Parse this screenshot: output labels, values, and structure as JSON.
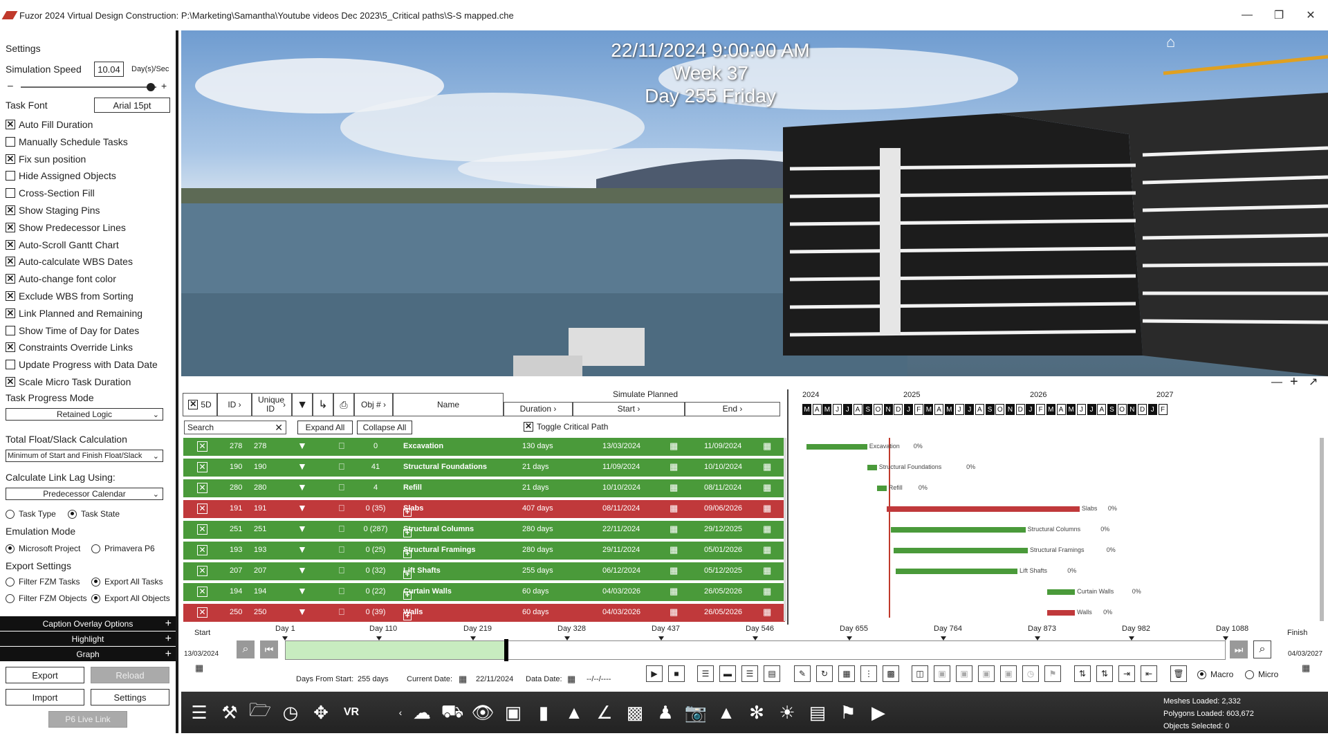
{
  "window": {
    "title": "Fuzor 2024 Virtual Design Construction: P:\\Marketing\\Samantha\\Youtube videos Dec 2023\\5_Critical paths\\S-S mapped.che"
  },
  "settings": {
    "header": "Settings",
    "sim_speed_label": "Simulation Speed",
    "sim_speed_value": "10.04",
    "sim_speed_unit": "Day(s)/Sec",
    "sim_speed_fraction": 0.96,
    "task_font_label": "Task Font",
    "task_font_value": "Arial 15pt",
    "checkboxes": [
      {
        "label": "Auto Fill Duration",
        "checked": true
      },
      {
        "label": "Manually Schedule Tasks",
        "checked": false
      },
      {
        "label": "Fix sun position",
        "checked": true
      },
      {
        "label": "Hide Assigned Objects",
        "checked": false
      },
      {
        "label": "Cross-Section Fill",
        "checked": false
      },
      {
        "label": "Show Staging Pins",
        "checked": true
      },
      {
        "label": "Show Predecessor Lines",
        "checked": true
      },
      {
        "label": "Auto-Scroll Gantt Chart",
        "checked": true
      },
      {
        "label": "Auto-calculate WBS Dates",
        "checked": true
      },
      {
        "label": "Auto-change font color",
        "checked": true
      },
      {
        "label": "Exclude WBS from Sorting",
        "checked": true
      },
      {
        "label": "Link Planned and Remaining",
        "checked": true
      },
      {
        "label": "Show Time of Day for Dates",
        "checked": false
      },
      {
        "label": "Constraints Override Links",
        "checked": true
      },
      {
        "label": "Update Progress with Data Date",
        "checked": false
      },
      {
        "label": "Scale Micro Task Duration",
        "checked": true
      }
    ],
    "task_progress_label": "Task Progress Mode",
    "task_progress_value": "Retained Logic",
    "float_label": "Total Float/Slack Calculation",
    "float_value": "Minimum of Start and Finish Float/Slack",
    "lag_label": "Calculate Link Lag Using:",
    "lag_value": "Predecessor Calendar",
    "task_type": "Task Type",
    "task_state": "Task State",
    "emulation_label": "Emulation Mode",
    "emu_ms": "Microsoft Project",
    "emu_p6": "Primavera P6",
    "export_label": "Export Settings",
    "filter_tasks": "Filter FZM Tasks",
    "export_all_tasks": "Export All Tasks",
    "filter_objects": "Filter FZM Objects",
    "export_all_objects": "Export All Objects",
    "sections": [
      "Caption Overlay Options",
      "Highlight",
      "Graph"
    ],
    "btn_export": "Export",
    "btn_reload": "Reload",
    "btn_import": "Import",
    "btn_settings": "Settings",
    "btn_p6": "P6 Live Link"
  },
  "overlay": {
    "datetime": "22/11/2024 9:00:00 AM",
    "week": "Week 37",
    "day": "Day 255 Friday"
  },
  "table": {
    "col_5d": "5D",
    "col_id": "ID",
    "col_uid": "Unique ID",
    "col_obj": "Obj #",
    "col_name": "Name",
    "sim_planned": "Simulate Planned",
    "col_duration": "Duration",
    "col_start": "Start",
    "col_end": "End",
    "search_placeholder": "Search",
    "expand_all": "Expand All",
    "collapse_all": "Collapse All",
    "toggle_critical": "Toggle Critical Path",
    "rows": [
      {
        "id": "278",
        "uid": "278",
        "obj": "0",
        "name": "Excavation",
        "dur": "130 days",
        "start": "13/03/2024",
        "end": "11/09/2024",
        "status": "green",
        "group": false
      },
      {
        "id": "190",
        "uid": "190",
        "obj": "41",
        "name": "Structural Foundations",
        "dur": "21 days",
        "start": "11/09/2024",
        "end": "10/10/2024",
        "status": "green",
        "group": false
      },
      {
        "id": "280",
        "uid": "280",
        "obj": "4",
        "name": "Refill",
        "dur": "21 days",
        "start": "10/10/2024",
        "end": "08/11/2024",
        "status": "green",
        "group": false
      },
      {
        "id": "191",
        "uid": "191",
        "obj": "0 (35)",
        "name": "Slabs",
        "dur": "407 days",
        "start": "08/11/2024",
        "end": "09/06/2026",
        "status": "red",
        "group": true
      },
      {
        "id": "251",
        "uid": "251",
        "obj": "0 (287)",
        "name": "Structural Columns",
        "dur": "280 days",
        "start": "22/11/2024",
        "end": "29/12/2025",
        "status": "green",
        "group": true
      },
      {
        "id": "193",
        "uid": "193",
        "obj": "0 (25)",
        "name": "Structural Framings",
        "dur": "280 days",
        "start": "29/11/2024",
        "end": "05/01/2026",
        "status": "green",
        "group": true
      },
      {
        "id": "207",
        "uid": "207",
        "obj": "0 (32)",
        "name": "Lift Shafts",
        "dur": "255 days",
        "start": "06/12/2024",
        "end": "05/12/2025",
        "status": "green",
        "group": true
      },
      {
        "id": "194",
        "uid": "194",
        "obj": "0 (22)",
        "name": "Curtain Walls",
        "dur": "60 days",
        "start": "04/03/2026",
        "end": "26/05/2026",
        "status": "green",
        "group": true
      },
      {
        "id": "250",
        "uid": "250",
        "obj": "0 (39)",
        "name": "Walls",
        "dur": "60 days",
        "start": "04/03/2026",
        "end": "26/05/2026",
        "status": "red",
        "group": true
      }
    ]
  },
  "gantt": {
    "years": [
      "2024",
      "2025",
      "2026",
      "2027"
    ],
    "months": [
      "M",
      "A",
      "M",
      "J",
      "J",
      "A",
      "S",
      "O",
      "N",
      "D",
      "J",
      "F",
      "M",
      "A",
      "M",
      "J",
      "J",
      "A",
      "S",
      "O",
      "N",
      "D",
      "J",
      "F",
      "M",
      "A",
      "M",
      "J",
      "J",
      "A",
      "S",
      "O",
      "N",
      "D",
      "J",
      "F"
    ],
    "tasks": [
      {
        "label": "Excavation",
        "pct": "0%"
      },
      {
        "label": "Structural Foundations",
        "pct": "0%"
      },
      {
        "label": "Refill",
        "pct": "0%"
      },
      {
        "label": "Slabs",
        "pct": "0%"
      },
      {
        "label": "Structural Columns",
        "pct": "0%"
      },
      {
        "label": "Structural Framings",
        "pct": "0%"
      },
      {
        "label": "Lift Shafts",
        "pct": "0%"
      },
      {
        "label": "Curtain Walls",
        "pct": "0%"
      },
      {
        "label": "Walls",
        "pct": "0%"
      }
    ]
  },
  "timeline": {
    "start_label": "Start",
    "finish_label": "Finish",
    "start_date": "13/03/2024",
    "finish_date": "04/03/2027",
    "ticks": [
      "Day 1",
      "Day 110",
      "Day 219",
      "Day 328",
      "Day 437",
      "Day 546",
      "Day 655",
      "Day 764",
      "Day 873",
      "Day 982",
      "Day 1088"
    ],
    "progress_fraction": 0.234,
    "days_from_start_label": "Days From Start:",
    "days_from_start": "255 days",
    "current_date_label": "Current Date:",
    "current_date": "22/11/2024",
    "data_date_label": "Data Date:",
    "data_date": "--/--/----",
    "macro": "Macro",
    "micro": "Micro"
  },
  "status": {
    "meshes": "Meshes Loaded: 2,332",
    "polygons": "Polygons Loaded: 603,672",
    "objects": "Objects Selected: 0"
  }
}
